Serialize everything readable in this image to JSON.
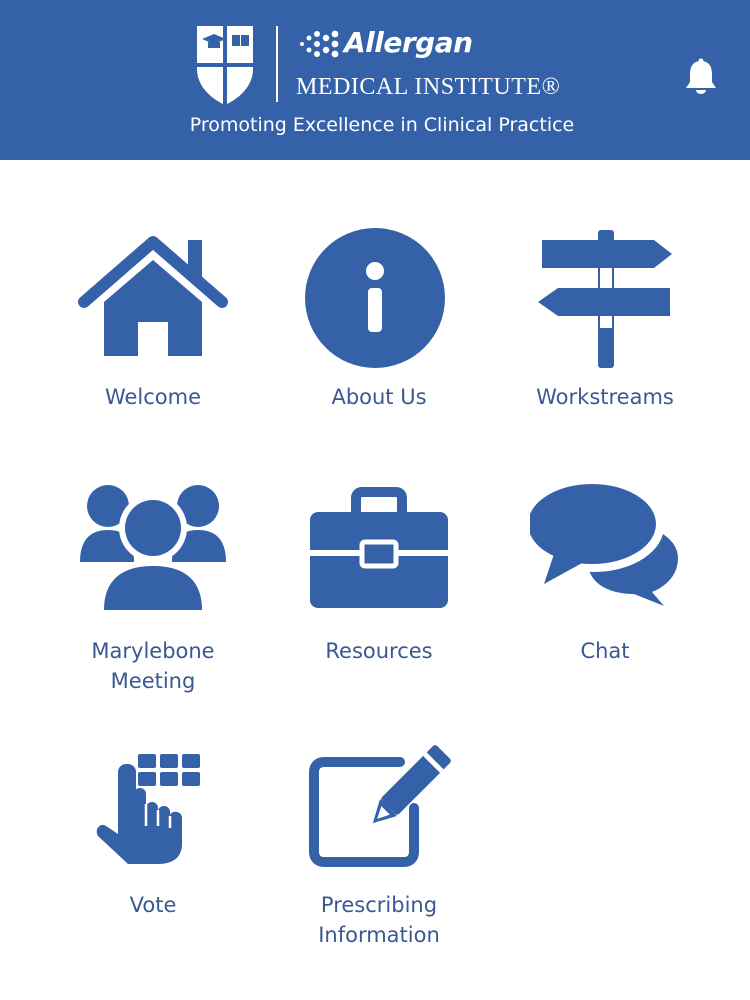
{
  "header": {
    "brand_name": "Allergan",
    "institute_name": "MEDICAL INSTITUTE®",
    "tagline": "Promoting Excellence in Clinical Practice",
    "background_color": "#3561a8",
    "logo_icon": "shield-crest-icon",
    "notification_icon": "bell-icon"
  },
  "theme": {
    "icon_color": "#3561a8",
    "label_color": "#3a5893"
  },
  "menu": {
    "items": [
      {
        "label": "Welcome",
        "icon": "house-icon"
      },
      {
        "label": "About Us",
        "icon": "info-icon"
      },
      {
        "label": "Workstreams",
        "icon": "signpost-icon"
      },
      {
        "label": "Marylebone\nMeeting",
        "icon": "people-group-icon"
      },
      {
        "label": "Resources",
        "icon": "briefcase-icon"
      },
      {
        "label": "Chat",
        "icon": "chat-bubbles-icon"
      },
      {
        "label": "Vote",
        "icon": "voting-keypad-icon"
      },
      {
        "label": "Prescribing\nInformation",
        "icon": "edit-pencil-icon"
      }
    ]
  }
}
